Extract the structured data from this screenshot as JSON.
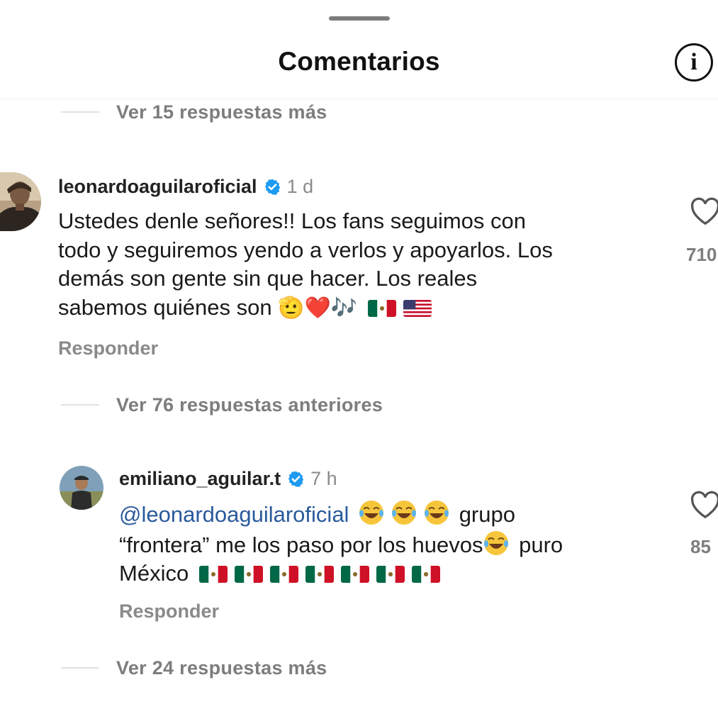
{
  "header": {
    "title": "Comentarios",
    "info_icon": "info-icon",
    "info_glyph": "i"
  },
  "threads": {
    "top": "Ver 15 respuestas más",
    "middle": "Ver 76 respuestas anteriores",
    "bottom": "Ver 24 respuestas más"
  },
  "comments": [
    {
      "username": "leonardoaguilaroficial",
      "time": "1 d",
      "text_line1": "Ustedes denle señores!! Los fans seguimos con",
      "text_line2": "todo y seguiremos yendo a verlos y apoyarlos. Los",
      "text_line3": "demás son gente sin que hacer. Los reales",
      "text_line4": "sabemos quiénes son",
      "emojis": "🫡❤️🎶",
      "reply_label": "Responder",
      "likes": "710",
      "colors": {
        "verified": "#1d9bf0"
      }
    },
    {
      "username": "emiliano_aguilar.t",
      "time": "7 h",
      "mention": "@leonardoaguilaroficial",
      "text_after_mention": " grupo",
      "text_line2a": "“frontera” me los paso por los huevos",
      "text_line2b": " puro",
      "text_line3": "México",
      "reply_label": "Responder",
      "likes": "85"
    }
  ],
  "colors": {
    "mention": "#2a5a9c",
    "muted": "#8a8a8a",
    "mexico_green": "#006847",
    "mexico_red": "#ce1126"
  }
}
